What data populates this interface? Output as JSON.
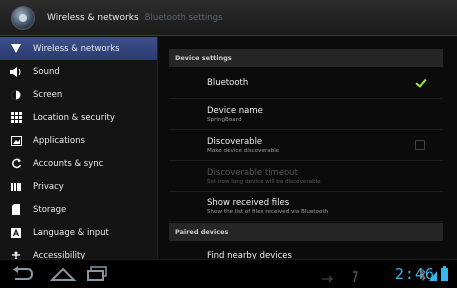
{
  "header": {
    "title": "Wireless & networks",
    "subtitle": "Bluetooth settings"
  },
  "sidebar": {
    "items": [
      {
        "label": "Wireless & networks",
        "icon": "wifi-icon",
        "selected": true
      },
      {
        "label": "Sound",
        "icon": "speaker-icon"
      },
      {
        "label": "Screen",
        "icon": "brightness-icon"
      },
      {
        "label": "Location & security",
        "icon": "grid-icon"
      },
      {
        "label": "Applications",
        "icon": "applications-icon"
      },
      {
        "label": "Accounts & sync",
        "icon": "sync-icon"
      },
      {
        "label": "Privacy",
        "icon": "privacy-icon"
      },
      {
        "label": "Storage",
        "icon": "storage-icon"
      },
      {
        "label": "Language & input",
        "icon": "language-icon"
      },
      {
        "label": "Accessibility",
        "icon": "accessibility-icon"
      }
    ]
  },
  "device_settings": {
    "header": "Device settings",
    "bluetooth": {
      "title": "Bluetooth",
      "checked": true
    },
    "device_name": {
      "title": "Device name",
      "summary": "SpringBoard"
    },
    "discoverable": {
      "title": "Discoverable",
      "summary": "Make device discoverable",
      "checked": false
    },
    "discoverable_timeout": {
      "title": "Discoverable timeout",
      "summary": "Set how long device will be discoverable",
      "enabled": false
    },
    "received_files": {
      "title": "Show received files",
      "summary": "Show the list of files received via Bluetooth"
    }
  },
  "paired_devices": {
    "header": "Paired devices",
    "find_nearby": {
      "title": "Find nearby devices"
    }
  },
  "system_bar": {
    "clock": "2:46",
    "accent_color": "#37b7ea"
  }
}
